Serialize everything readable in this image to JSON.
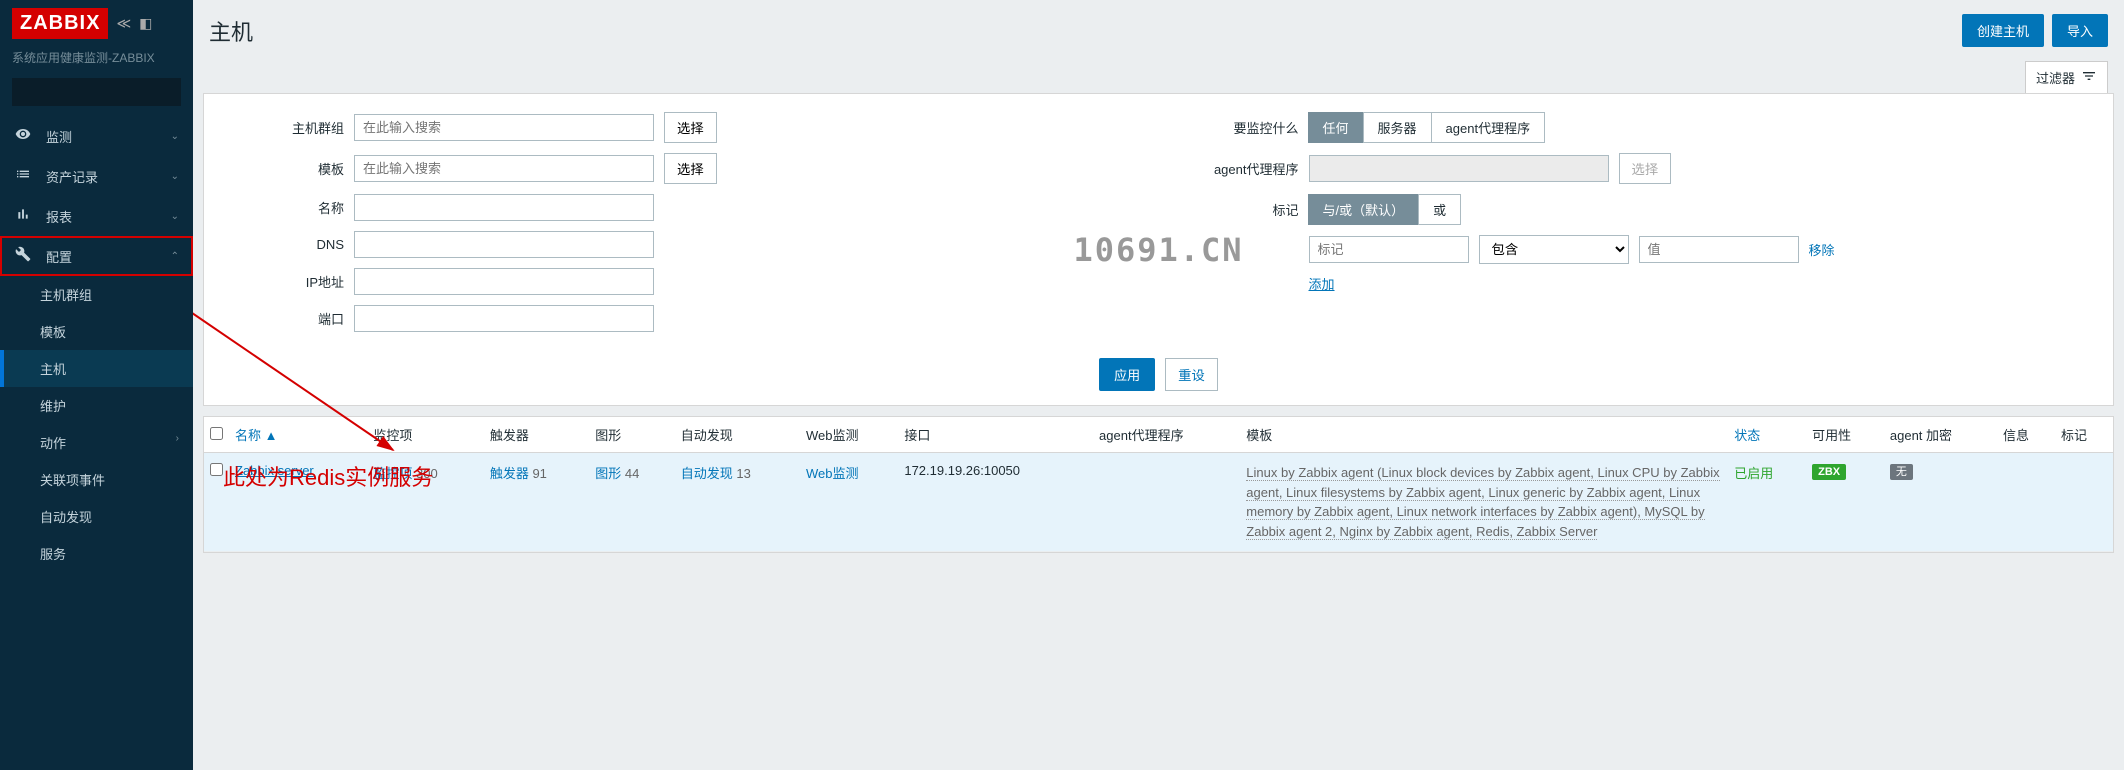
{
  "logo": "ZABBIX",
  "subtitle": "系统应用健康监测-ZABBIX",
  "nav": {
    "monitor": "监测",
    "inventory": "资产记录",
    "reports": "报表",
    "config": "配置",
    "config_items": {
      "hostgroups": "主机群组",
      "templates": "模板",
      "hosts": "主机",
      "maintenance": "维护",
      "actions": "动作",
      "correlation": "关联项事件",
      "discovery": "自动发现",
      "services": "服务"
    }
  },
  "page": {
    "title": "主机",
    "create_btn": "创建主机",
    "import_btn": "导入",
    "filter_label": "过滤器"
  },
  "filter": {
    "hostgroup_label": "主机群组",
    "template_label": "模板",
    "name_label": "名称",
    "dns_label": "DNS",
    "ip_label": "IP地址",
    "port_label": "端口",
    "search_placeholder": "在此输入搜索",
    "select_btn": "选择",
    "monitor_what_label": "要监控什么",
    "monitor_opts": {
      "any": "任何",
      "server": "服务器",
      "proxy": "agent代理程序"
    },
    "proxy_label": "agent代理程序",
    "tags_label": "标记",
    "tag_opts": {
      "andor": "与/或（默认）",
      "or": "或"
    },
    "tag_key_placeholder": "标记",
    "tag_op": "包含",
    "tag_val_placeholder": "值",
    "remove": "移除",
    "add": "添加",
    "apply": "应用",
    "reset": "重设"
  },
  "watermark": "10691.CN",
  "table": {
    "headers": {
      "name": "名称",
      "items": "监控项",
      "triggers": "触发器",
      "graphs": "图形",
      "discovery": "自动发现",
      "web": "Web监测",
      "interface": "接口",
      "proxy": "agent代理程序",
      "templates": "模板",
      "status": "状态",
      "availability": "可用性",
      "agent": "agent 加密",
      "info": "信息",
      "tags": "标记"
    },
    "row": {
      "name": "Zabbix server",
      "items": "监控项",
      "items_count": "300",
      "triggers": "触发器",
      "triggers_count": "91",
      "graphs": "图形",
      "graphs_count": "44",
      "discovery": "自动发现",
      "discovery_count": "13",
      "web": "Web监测",
      "interface": "172.19.19.26:10050",
      "templates_text": "Linux by Zabbix agent (Linux block devices by Zabbix agent, Linux CPU by Zabbix agent, Linux filesystems by Zabbix agent, Linux generic by Zabbix agent, Linux memory by Zabbix agent, Linux network interfaces by Zabbix agent), MySQL by Zabbix agent 2, Nginx by Zabbix agent, Redis, Zabbix Server",
      "status": "已启用",
      "avail_zbx": "ZBX",
      "encrypt": "无"
    }
  },
  "annotation_text": "此处为Redis实例服务"
}
